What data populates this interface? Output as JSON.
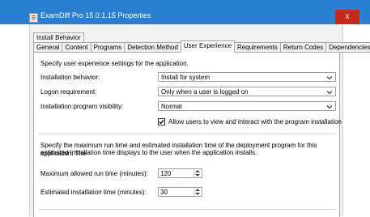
{
  "window": {
    "title": "ExamDiff Pro 15.0.1.15 Properties",
    "close_glyph": "x"
  },
  "group_tab": "Install Behavior",
  "tabs": [
    "General",
    "Content",
    "Programs",
    "Detection Method",
    "User Experience",
    "Requirements",
    "Return Codes",
    "Dependencies"
  ],
  "active_tab": "User Experience",
  "panel": {
    "intro": "Specify user experience settings for the application.",
    "installation_behavior": {
      "label": "Installation behavior:",
      "value": "Install for system"
    },
    "logon_requirement": {
      "label": "Logon requirement:",
      "value": "Only when a user is logged on"
    },
    "visibility": {
      "label": "Installation program visibility:",
      "value": "Normal"
    },
    "allow_interact": {
      "label": "Allow users to view and interact with the program installation",
      "checked": true
    },
    "runtime_desc_1": "Specify the maximum run time and estimated installation time of the deployment program for this application. The",
    "runtime_desc_2": "estimated installation time displays to the user when the application installs.",
    "max_runtime": {
      "label": "Maximum allowed run time (minutes):",
      "value": "120"
    },
    "est_time": {
      "label": "Estimated installation time (minutes):",
      "value": "30"
    }
  }
}
